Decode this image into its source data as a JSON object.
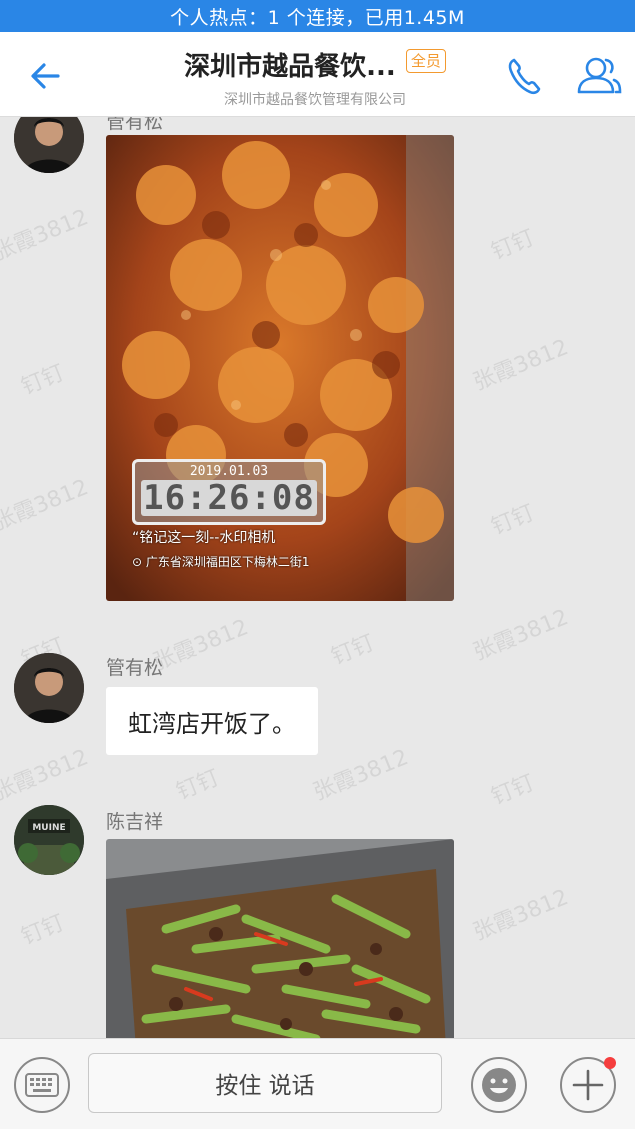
{
  "status_bar": {
    "hotspot_text": "个人热点：1 个连接，已用1.45M"
  },
  "header": {
    "title": "深圳市越品餐饮...",
    "badge": "全员",
    "subtitle": "深圳市越品餐饮管理有限公司"
  },
  "messages": [
    {
      "sender": "管有松",
      "type": "image",
      "image_desc": "fried-food-photo",
      "watermark": {
        "date": "2019.01.03",
        "time": "16:26:08",
        "tagline": "“铭记这一刻--水印相机",
        "location": "广东省深圳福田区下梅林二街1"
      }
    },
    {
      "sender": "管有松",
      "type": "text",
      "text": "虹湾店开饭了。"
    },
    {
      "sender": "陈吉祥",
      "type": "image",
      "image_desc": "green-beans-photo",
      "avatar_text": "MUINE"
    }
  ],
  "watermark_text": [
    "张霞3812",
    "钉钉"
  ],
  "input_bar": {
    "push_to_talk_label": "按住 说话"
  },
  "colors": {
    "accent": "#2a86e6",
    "badge": "#f39a2f",
    "notify_dot": "#f53d3d"
  }
}
